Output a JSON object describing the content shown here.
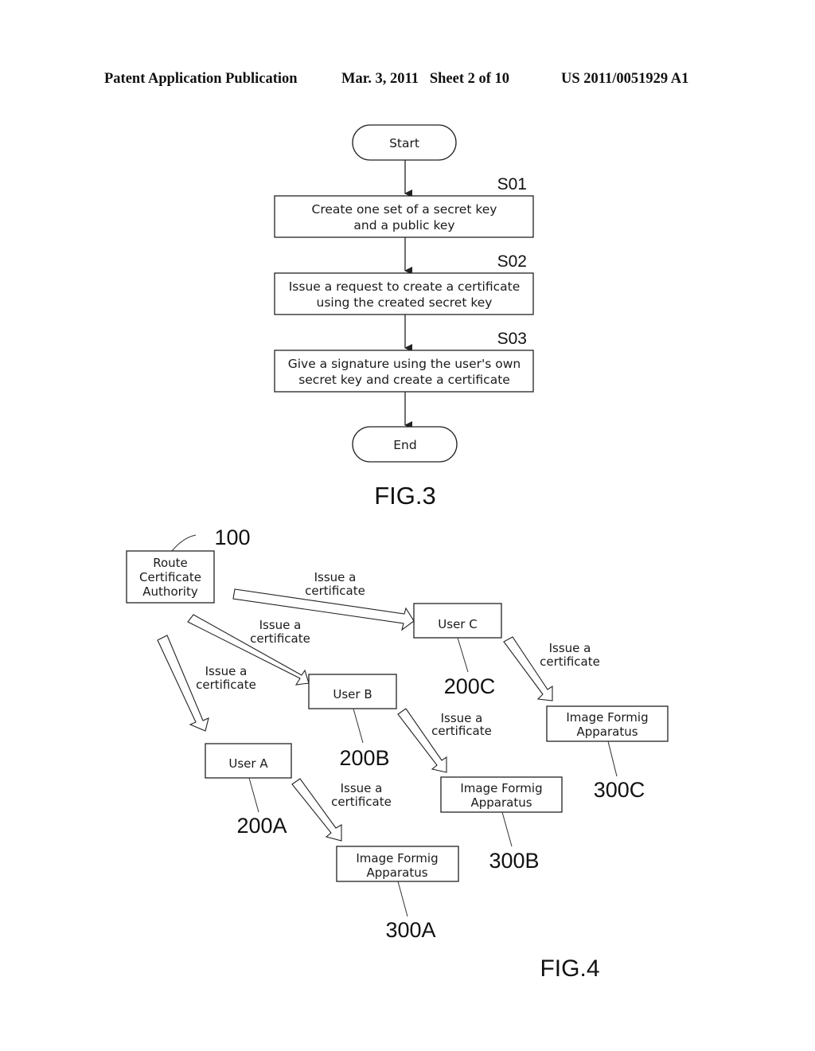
{
  "header": {
    "publication": "Patent Application Publication",
    "date_sheet": "Mar. 3, 2011   Sheet 2 of 10",
    "number": "US 2011/0051929 A1"
  },
  "fig3": {
    "caption": "FIG.3",
    "start": "Start",
    "end": "End",
    "steps": [
      {
        "id": "S01",
        "line1": "Create one set of a secret key",
        "line2": "and a public key"
      },
      {
        "id": "S02",
        "line1": "Issue a request to create a certificate",
        "line2": "using the created secret key"
      },
      {
        "id": "S03",
        "line1": "Give a signature using the user's own",
        "line2": "secret key and create a certificate"
      }
    ]
  },
  "fig4": {
    "caption": "FIG.4",
    "root": {
      "ref": "100",
      "line1": "Route",
      "line2": "Certificate",
      "line3": "Authority"
    },
    "users": [
      {
        "label": "User A",
        "ref": "200A"
      },
      {
        "label": "User B",
        "ref": "200B"
      },
      {
        "label": "User C",
        "ref": "200C"
      }
    ],
    "apparatus": [
      {
        "line1": "Image Formig",
        "line2": "Apparatus",
        "ref": "300A"
      },
      {
        "line1": "Image Formig",
        "line2": "Apparatus",
        "ref": "300B"
      },
      {
        "line1": "Image Formig",
        "line2": "Apparatus",
        "ref": "300C"
      }
    ],
    "arrow_label": {
      "line1": "Issue a",
      "line2": "certificate"
    }
  }
}
